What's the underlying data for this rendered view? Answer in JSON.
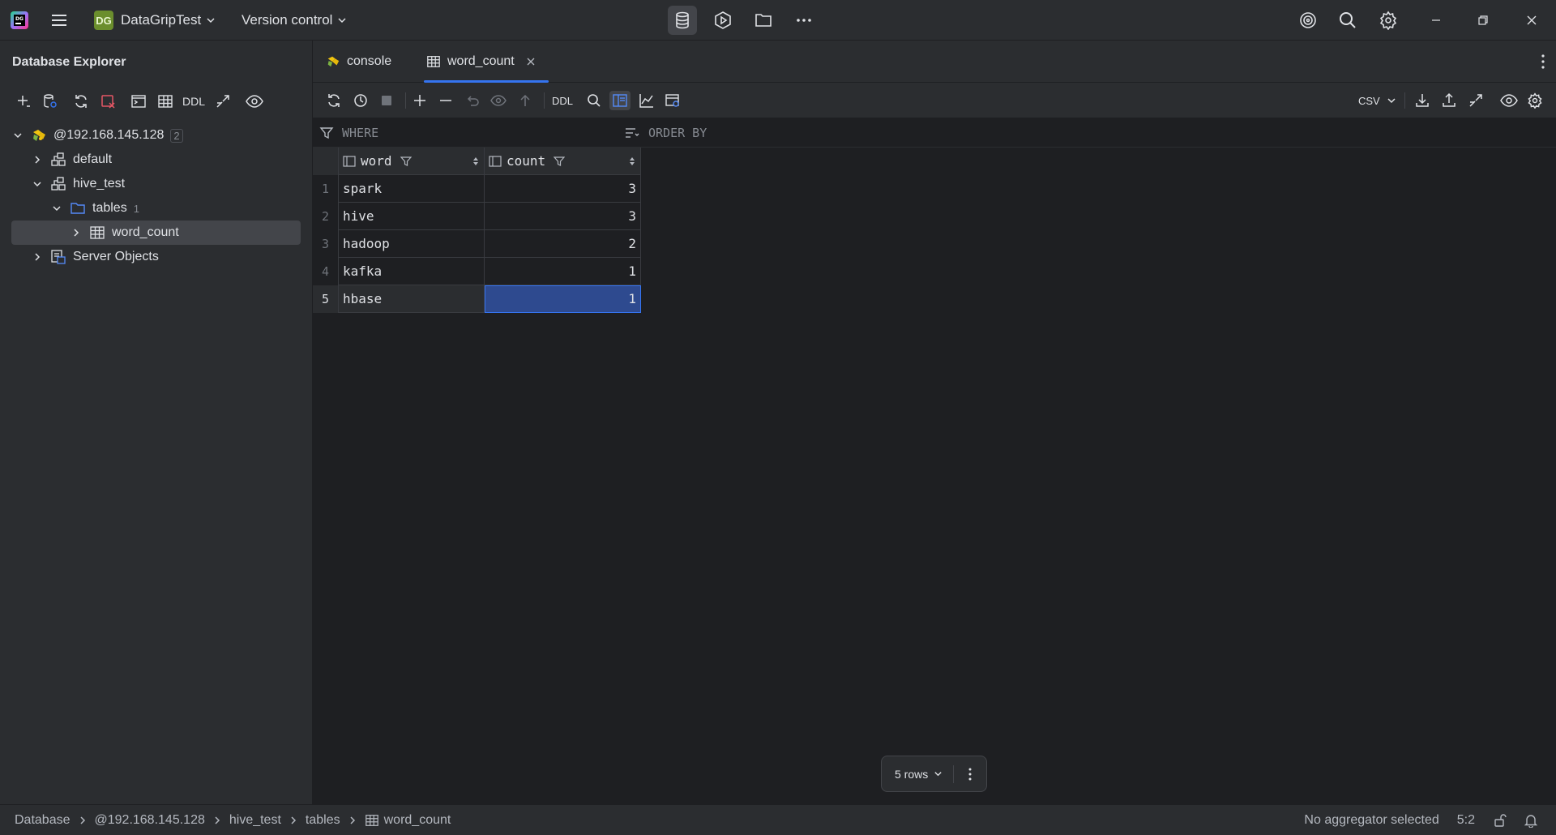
{
  "titlebar": {
    "project_badge": "DG",
    "project_name": "DataGripTest",
    "vcs_label": "Version control"
  },
  "explorer": {
    "title": "Database Explorer",
    "ddl_label": "DDL",
    "tree": {
      "host": "@192.168.145.128",
      "host_count": "2",
      "default": "default",
      "hive_test": "hive_test",
      "tables": "tables",
      "tables_count": "1",
      "word_count": "word_count",
      "server_objects": "Server Objects"
    }
  },
  "tabs": [
    {
      "label": "console"
    },
    {
      "label": "word_count"
    }
  ],
  "toolbar": {
    "ddl_label": "DDL",
    "export_format": "CSV"
  },
  "filter": {
    "where_label": "WHERE",
    "orderby_label": "ORDER BY"
  },
  "table": {
    "columns": [
      "word",
      "count"
    ],
    "rows": [
      {
        "num": "1",
        "word": "spark",
        "count": "3"
      },
      {
        "num": "2",
        "word": "hive",
        "count": "3"
      },
      {
        "num": "3",
        "word": "hadoop",
        "count": "2"
      },
      {
        "num": "4",
        "word": "kafka",
        "count": "1"
      },
      {
        "num": "5",
        "word": "hbase",
        "count": "1"
      }
    ]
  },
  "pager": {
    "rows_label": "5 rows"
  },
  "statusbar": {
    "breadcrumbs": [
      "Database",
      "@192.168.145.128",
      "hive_test",
      "tables",
      "word_count"
    ],
    "aggregator": "No aggregator selected",
    "position": "5:2"
  },
  "colors": {
    "background": "#1e1f22",
    "panel": "#2b2d30",
    "accent": "#3574f0",
    "selection": "#2e4a8f"
  }
}
